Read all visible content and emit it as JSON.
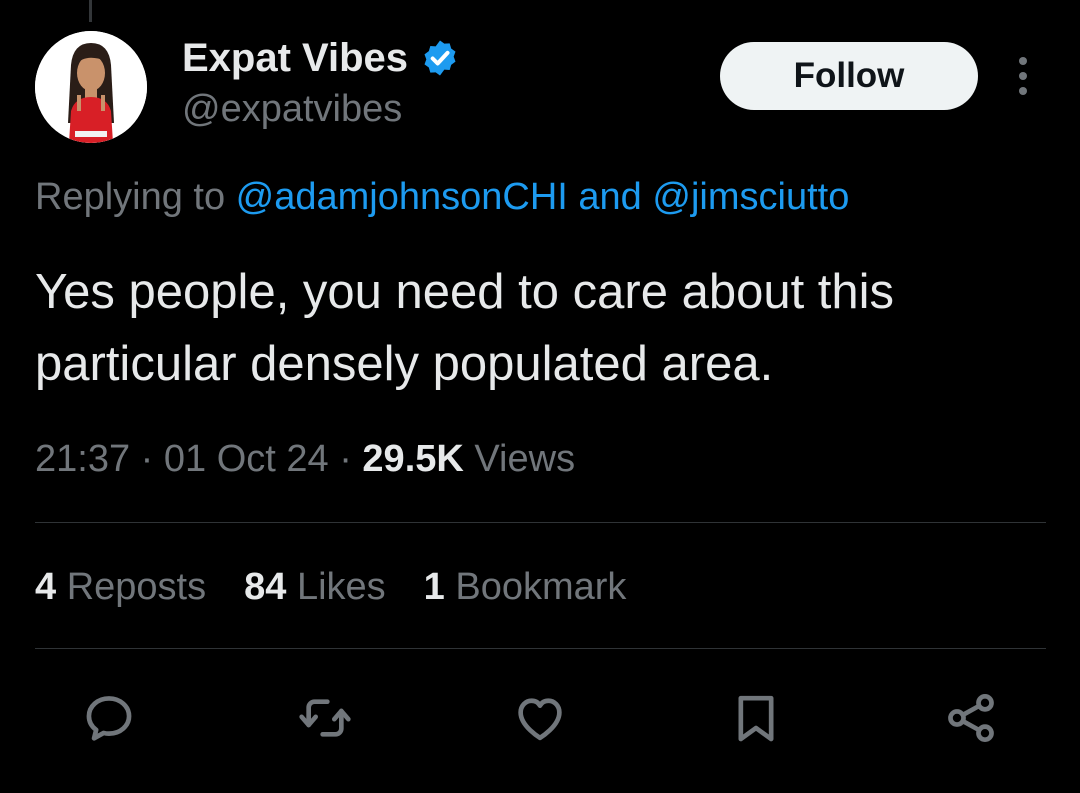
{
  "tweet": {
    "author": {
      "display_name": "Expat Vibes",
      "handle": "@expatvibes",
      "verified": true,
      "avatar_icon": "avatar-illustration"
    },
    "follow_label": "Follow",
    "reply_prefix": "Replying to ",
    "reply_mention_1": "@adamjohnsonCHI",
    "reply_and": " and ",
    "reply_mention_2": "@jimsciutto",
    "text_line_1": "Yes people, you need to care about this",
    "text_line_2": "particular densely populated area.",
    "time": "21:37",
    "date": "01 Oct 24",
    "separator": " · ",
    "views_count": "29.5K",
    "views_label": " Views",
    "stats": {
      "reposts_count": "4",
      "reposts_label": " Reposts",
      "likes_count": "84",
      "likes_label": " Likes",
      "bookmarks_count": "1",
      "bookmarks_label": " Bookmark"
    },
    "actions": [
      "reply-icon",
      "repost-icon",
      "like-icon",
      "bookmark-icon",
      "share-icon"
    ]
  },
  "colors": {
    "background": "#000000",
    "primary_text": "#e7e9ea",
    "secondary_text": "#71767b",
    "accent": "#1d9bf0",
    "divider": "#2f3336"
  }
}
